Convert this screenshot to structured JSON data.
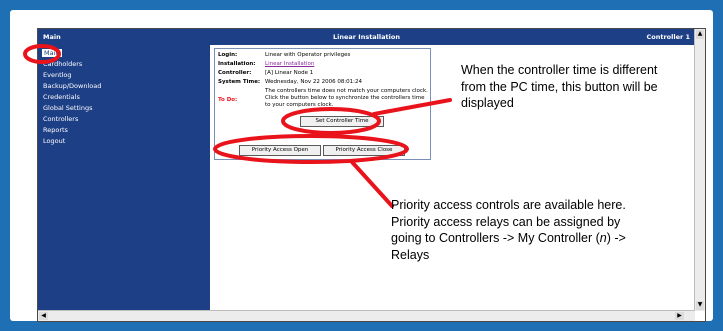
{
  "window": {
    "title_left": "Main",
    "title_center": "Linear Installation",
    "title_right": "Controller 1"
  },
  "sidebar": {
    "items": [
      {
        "label": "Main"
      },
      {
        "label": "Cardholders"
      },
      {
        "label": "Eventlog"
      },
      {
        "label": "Backup/Download"
      },
      {
        "label": "Credentials"
      },
      {
        "label": "Global Settings"
      },
      {
        "label": "Controllers"
      },
      {
        "label": "Reports"
      },
      {
        "label": "Logout"
      }
    ]
  },
  "info": {
    "login_label": "Login:",
    "login_value": "Linear with Operator privileges",
    "installation_label": "Installation:",
    "installation_value": "Linear Installation",
    "controller_label": "Controller:",
    "controller_value": "[A] Linear Node 1",
    "system_time_label": "System Time:",
    "system_time_value": "Wednesday, Nov 22 2006 08:01:24",
    "todo_label": "To Do:",
    "message": "The controllers time does not match your computers clock. Click the button below to synchronize the controllers time to your computers clock.",
    "set_time_button": "Set Controller Time",
    "priority_open_button": "Priority Access Open",
    "priority_close_button": "Priority Access Close"
  },
  "callouts": {
    "top": "When the controller time is different from the PC time, this button will be displayed",
    "bottom_1": "Priority access controls are available here. Priority access relays can be assigned by going to Controllers -> My Controller (",
    "bottom_n": "n",
    "bottom_2": ") -> Relays"
  },
  "colors": {
    "frame_bg": "#1f6fb5",
    "nav_bg": "#1d3f86",
    "annotation_red": "#e8131b"
  }
}
